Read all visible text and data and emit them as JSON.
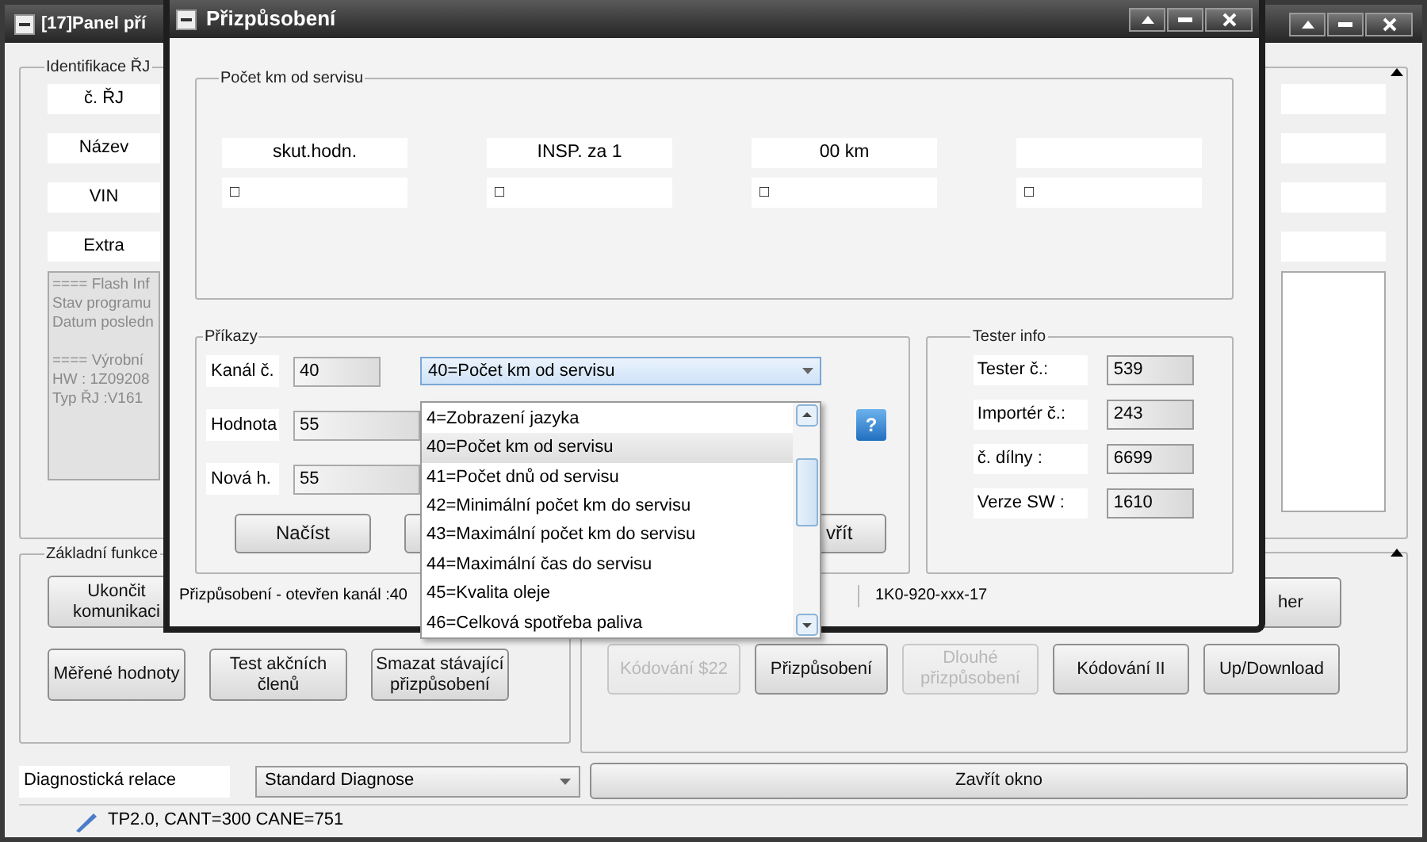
{
  "back_window": {
    "title": "[17]Panel pří",
    "identification": {
      "title": "Identifikace ŘJ",
      "labels": [
        "č. ŘJ",
        "Název",
        "VIN",
        "Extra"
      ],
      "info_blocks": [
        [
          "==== Flash Inf",
          "Stav programu",
          "Datum posledn"
        ],
        [
          "==== Výrobní",
          "HW : 1Z09208",
          "Typ ŘJ :V161"
        ]
      ]
    },
    "basic_functions": {
      "title": "Základní funkce",
      "row_1": [
        "Ukončit komunikaci"
      ],
      "row_2": [
        "Měřené hodnoty",
        "Test akčních členů",
        "Smazat stávající přizpůsobení"
      ]
    },
    "more_functions": {
      "row_1_last": "her",
      "row_2": [
        {
          "label": "Kódování $22",
          "disabled": true
        },
        {
          "label": "Přizpůsobení",
          "disabled": false
        },
        {
          "label": "Dlouhé přizpůsobení",
          "disabled": true
        },
        {
          "label": "Kódování II",
          "disabled": false
        },
        {
          "label": "Up/Download",
          "disabled": false
        }
      ]
    },
    "session": {
      "label": "Diagnostická relace",
      "value": "Standard Diagnose"
    },
    "close_button": "Zavřít okno",
    "status_bar": "TP2.0, CANT=300 CANE=751"
  },
  "dialog": {
    "title": "Přizpůsobení",
    "km_group": {
      "title": "Počet km od servisu",
      "columns": [
        {
          "header": "skut.hodn.",
          "value": "□"
        },
        {
          "header": "INSP. za 1",
          "value": "□"
        },
        {
          "header": "00 km",
          "value": "□"
        },
        {
          "value": "□"
        }
      ]
    },
    "commands": {
      "title": "Příkazy",
      "channel": {
        "label": "Kanál č.",
        "value": "40"
      },
      "value": {
        "label": "Hodnota",
        "value": "55"
      },
      "new_value": {
        "label": "Nová h.",
        "value": "55"
      },
      "channel_select": {
        "value": "40=Počet km od servisu",
        "expanded": true,
        "options": [
          {
            "label": "4=Zobrazení jazyka",
            "selected": false
          },
          {
            "label": "40=Počet km od servisu",
            "selected": true
          },
          {
            "label": "41=Počet dnů od servisu",
            "selected": false
          },
          {
            "label": "42=Minimální počet km do servisu",
            "selected": false
          },
          {
            "label": "43=Maximální počet km do servisu",
            "selected": false
          },
          {
            "label": "44=Maximální čas do servisu",
            "selected": false
          },
          {
            "label": "45=Kvalita oleje",
            "selected": false
          },
          {
            "label": "46=Celková spotřeba paliva",
            "selected": false
          }
        ]
      },
      "read_button": "Načíst",
      "close_button_part": "vřít",
      "help": "?"
    },
    "tester_info": {
      "title": "Tester info",
      "rows": [
        {
          "label": "Tester č.:",
          "value": "539"
        },
        {
          "label": "Importér č.:",
          "value": "243"
        },
        {
          "label": "č. dílny :",
          "value": "6699"
        },
        {
          "label": "Verze SW :",
          "value": "1610"
        }
      ]
    },
    "status_bar": [
      "Přizpůsobení - otevřen kanál :40",
      "1K0-920-xxx-17"
    ]
  }
}
